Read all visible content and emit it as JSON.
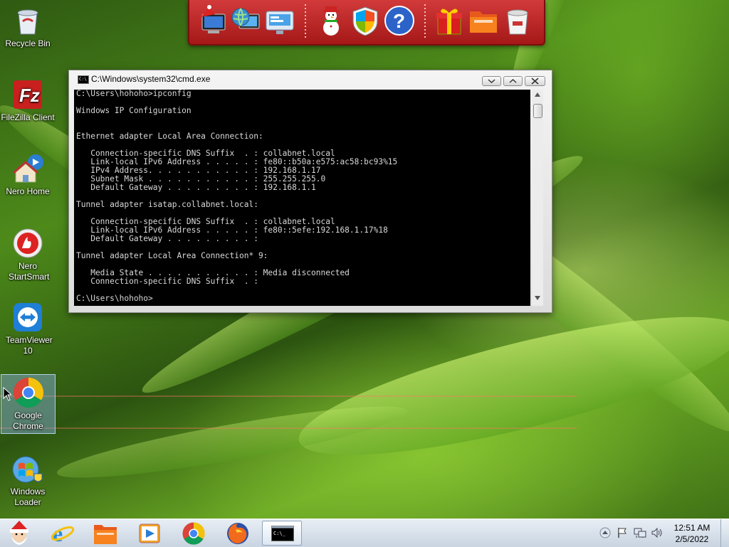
{
  "desktop": {
    "icons": [
      {
        "label": "Recycle Bin"
      },
      {
        "label": "FileZilla Client"
      },
      {
        "label": "Nero Home"
      },
      {
        "label": "Nero StartSmart"
      },
      {
        "label": "TeamViewer 10"
      },
      {
        "label": "Google Chrome"
      },
      {
        "label": "Windows Loader"
      }
    ]
  },
  "dock": {
    "items": [
      "computer-santa-icon",
      "network-globe-icon",
      "display-settings-icon",
      "snowman-icon",
      "windows-shield-icon",
      "help-icon",
      "gift-icon",
      "folder-icon",
      "trash-icon"
    ]
  },
  "cmd": {
    "title": "C:\\Windows\\system32\\cmd.exe",
    "icon_text": "C:\\",
    "lines": [
      "C:\\Users\\hohoho>ipconfig",
      "",
      "Windows IP Configuration",
      "",
      "",
      "Ethernet adapter Local Area Connection:",
      "",
      "   Connection-specific DNS Suffix  . : collabnet.local",
      "   Link-local IPv6 Address . . . . . : fe80::b50a:e575:ac58:bc93%15",
      "   IPv4 Address. . . . . . . . . . . : 192.168.1.17",
      "   Subnet Mask . . . . . . . . . . . : 255.255.255.0",
      "   Default Gateway . . . . . . . . . : 192.168.1.1",
      "",
      "Tunnel adapter isatap.collabnet.local:",
      "",
      "   Connection-specific DNS Suffix  . : collabnet.local",
      "   Link-local IPv6 Address . . . . . : fe80::5efe:192.168.1.17%18",
      "   Default Gateway . . . . . . . . . :",
      "",
      "Tunnel adapter Local Area Connection* 9:",
      "",
      "   Media State . . . . . . . . . . . : Media disconnected",
      "   Connection-specific DNS Suffix  . :",
      "",
      "C:\\Users\\hohoho>"
    ]
  },
  "taskbar": {
    "pinned": [
      "santa-start-icon",
      "internet-explorer-icon",
      "file-explorer-icon",
      "media-player-icon",
      "chrome-icon",
      "firefox-icon",
      "cmd-icon"
    ],
    "clock_time": "12:51 AM",
    "clock_date": "2/5/2022"
  }
}
